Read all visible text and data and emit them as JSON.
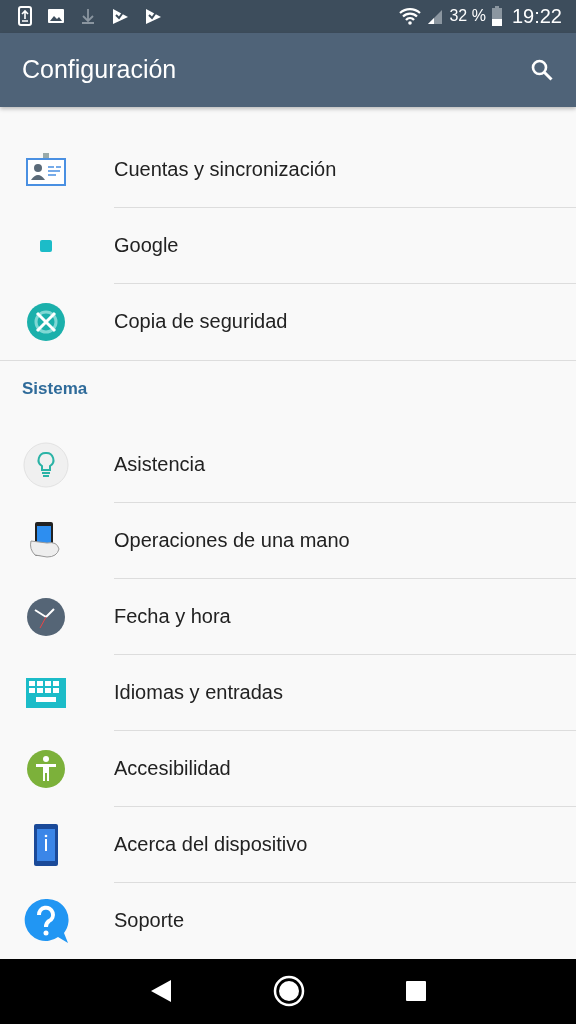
{
  "status_bar": {
    "battery_percent": "32 %",
    "time": "19:22"
  },
  "toolbar": {
    "title": "Configuración"
  },
  "sections": [
    {
      "items": [
        {
          "label": "Cuentas y sincronización"
        },
        {
          "label": "Google"
        },
        {
          "label": "Copia de seguridad"
        }
      ]
    },
    {
      "header": "Sistema",
      "items": [
        {
          "label": "Asistencia"
        },
        {
          "label": "Operaciones de una mano"
        },
        {
          "label": "Fecha y hora"
        },
        {
          "label": "Idiomas y entradas"
        },
        {
          "label": "Accesibilidad"
        },
        {
          "label": "Acerca del dispositivo"
        },
        {
          "label": "Soporte"
        }
      ]
    }
  ]
}
